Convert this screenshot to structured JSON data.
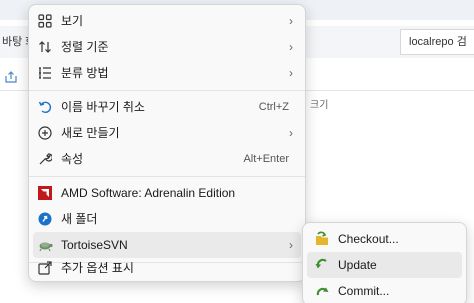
{
  "background": {
    "path_text": "바탕 화",
    "search_text": "localrepo 검",
    "column_header": "크기"
  },
  "context_menu": {
    "items": [
      {
        "label": "보기",
        "icon": "grid-icon",
        "submenu": true
      },
      {
        "label": "정렬 기준",
        "icon": "sort-icon",
        "submenu": true
      },
      {
        "label": "분류 방법",
        "icon": "group-icon",
        "submenu": true
      },
      {
        "label": "이름 바꾸기 취소",
        "icon": "undo-icon",
        "shortcut": "Ctrl+Z"
      },
      {
        "label": "새로 만들기",
        "icon": "add-icon",
        "submenu": true
      },
      {
        "label": "속성",
        "icon": "wrench-icon",
        "shortcut": "Alt+Enter"
      },
      {
        "label": "AMD Software: Adrenalin Edition",
        "icon": "amd-logo-icon"
      },
      {
        "label": "새 폴더",
        "icon": "new-folder-icon"
      },
      {
        "label": "TortoiseSVN",
        "icon": "tortoise-icon",
        "submenu": true
      },
      {
        "label": "추가 옵션 표시",
        "icon": "share-icon"
      }
    ]
  },
  "submenu": {
    "items": [
      {
        "label": "Checkout...",
        "icon": "checkout-icon"
      },
      {
        "label": "Update",
        "icon": "update-icon"
      },
      {
        "label": "Commit...",
        "icon": "commit-icon"
      }
    ]
  },
  "colors": {
    "menu_bg": "#f9f9f9",
    "highlight": "#eaeaea",
    "amd_red": "#c0191c",
    "svn_green": "#3f8f2e",
    "folder_blue": "#1a73c8"
  }
}
